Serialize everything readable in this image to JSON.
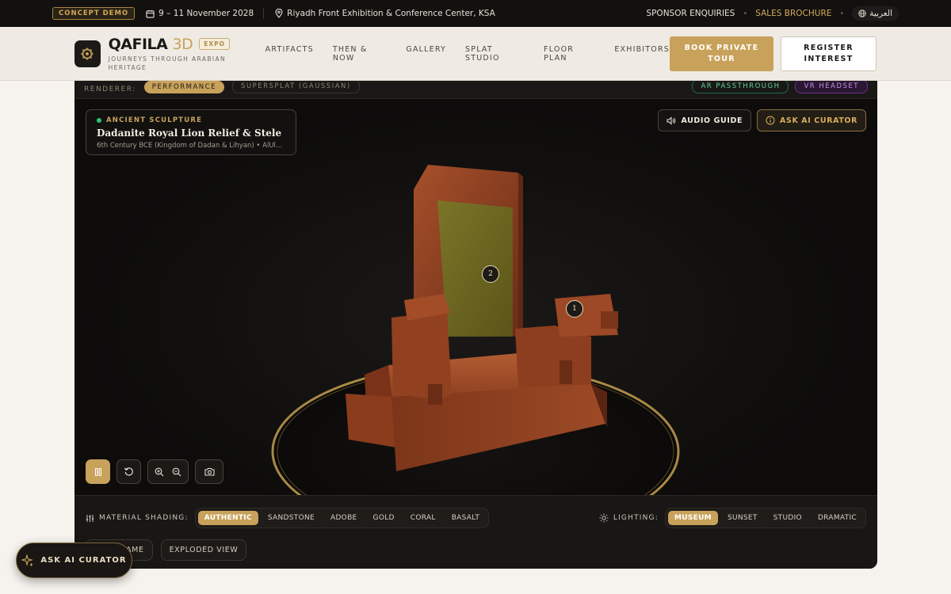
{
  "topbar": {
    "badge": "CONCEPT DEMO",
    "dates": "9 – 11 November 2028",
    "venue": "Riyadh Front Exhibition & Conference Center, KSA",
    "sponsor": "SPONSOR ENQUIRIES",
    "brochure": "SALES BROCHURE",
    "language": "العربية"
  },
  "nav": {
    "brand": "QAFILA",
    "brand_accent": "3D",
    "expo": "EXPO",
    "tagline": "JOURNEYS THROUGH ARABIAN HERITAGE",
    "links": [
      "ARTIFACTS",
      "THEN & NOW",
      "GALLERY",
      "SPLAT STUDIO",
      "FLOOR PLAN",
      "EXHIBITORS"
    ],
    "cta_primary": "BOOK PRIVATE TOUR",
    "cta_secondary": "REGISTER INTEREST"
  },
  "renderer": {
    "label": "RENDERER:",
    "opt1": "PERFORMANCE",
    "opt2": "SUPERSPLAT (GAUSSIAN)",
    "vr1": "AR PASSTHROUGH",
    "vr2": "VR HEADSET"
  },
  "artifact": {
    "category": "ANCIENT SCULPTURE",
    "title": "Dadanite Royal Lion Relief & Stele",
    "subtitle": "6th Century BCE (Kingdom of Dadan & Lihyan) • AlUla O..."
  },
  "actions": {
    "audio": "AUDIO GUIDE",
    "curator": "ASK AI CURATOR"
  },
  "hotspots": [
    "1",
    "2"
  ],
  "material": {
    "label": "MATERIAL SHADING:",
    "options": [
      "AUTHENTIC",
      "SANDSTONE",
      "ADOBE",
      "GOLD",
      "CORAL",
      "BASALT"
    ],
    "selected": "AUTHENTIC"
  },
  "lighting": {
    "label": "LIGHTING:",
    "options": [
      "MUSEUM",
      "SUNSET",
      "STUDIO",
      "DRAMATIC"
    ],
    "selected": "MUSEUM"
  },
  "bottom_buttons": {
    "wireframe": "WIREFRAME",
    "exploded": "EXPLODED VIEW"
  },
  "float_curator": "ASK AI CURATOR",
  "colors": {
    "gold": "#c8a25a",
    "dark": "#161412",
    "terracotta": "#8a3a1f",
    "inscription": "#6e6a22"
  }
}
